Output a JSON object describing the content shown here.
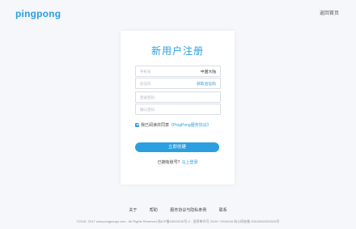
{
  "header": {
    "logo": "pingpong",
    "home_link": "返回首页"
  },
  "form": {
    "title": "新用户注册",
    "phone": {
      "placeholder": "手机号",
      "region": "中国大陆"
    },
    "code": {
      "placeholder": "验证码",
      "action": "获取验证码"
    },
    "password": {
      "placeholder": "登录密码"
    },
    "confirm": {
      "placeholder": "确认密码"
    },
    "agreement": {
      "text": "我已阅读并同意",
      "link": "《PingPong服务协议》",
      "checked": true
    },
    "submit": "立即创建",
    "login_prompt": "已拥有账号?",
    "login_link": "马上登录"
  },
  "footer": {
    "links": [
      "关于",
      "帮助",
      "服务协议与隐私条例",
      "联系"
    ],
    "copyright": "©2015- 2017 www.pingpongx.com . All Rights Reserved.浙ICP备16020130号-2 · 浙贸单许可 2015一2016044 杭公网安备 33010602002026号"
  },
  "colors": {
    "accent": "#2b9fe0",
    "background": "#f5f7fa",
    "card": "#ffffff"
  }
}
